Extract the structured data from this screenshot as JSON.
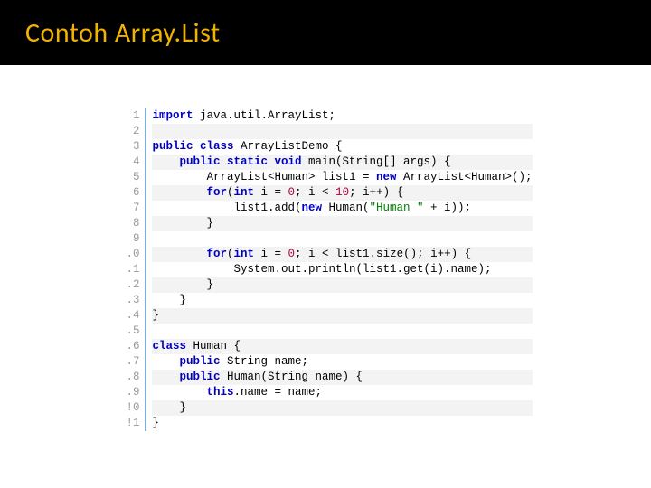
{
  "title": "Contoh Array.List",
  "line_numbers": [
    "1",
    "2",
    "3",
    "4",
    "5",
    "6",
    "7",
    "8",
    "9",
    ".0",
    ".1",
    ".2",
    ".3",
    ".4",
    ".5",
    ".6",
    ".7",
    ".8",
    ".9",
    "!0",
    "!1"
  ],
  "code": {
    "l1": {
      "kw1": "import",
      "rest": " java.util.ArrayList;"
    },
    "l2": {
      "blank": " "
    },
    "l3": {
      "kw1": "public class",
      "name": " ArrayListDemo ",
      "brace": "{"
    },
    "l4": {
      "pad": "    ",
      "kw1": "public static void",
      "name": " main(String[] args) ",
      "brace": "{"
    },
    "l5": {
      "pad": "        ",
      "pre": "ArrayList<Human> list1 = ",
      "kw1": "new",
      "post": " ArrayList<Human>();"
    },
    "l6": {
      "pad": "        ",
      "kw1": "for",
      "open": "(",
      "kw2": "int",
      "var": " i = ",
      "n0": "0",
      "mid": "; i < ",
      "n1": "10",
      "end": "; i++) {"
    },
    "l7": {
      "pad": "            ",
      "pre": "list1.add(",
      "kw1": "new",
      "mid": " Human(",
      "str": "\"Human \"",
      "post": " + i));"
    },
    "l8": {
      "pad": "        ",
      "brace": "}"
    },
    "l9": {
      "blank": " "
    },
    "l10": {
      "pad": "        ",
      "kw1": "for",
      "open": "(",
      "kw2": "int",
      "var": " i = ",
      "n0": "0",
      "end": "; i < list1.size(); i++) {"
    },
    "l11": {
      "pad": "            ",
      "text": "System.out.println(list1.get(i).name);"
    },
    "l12": {
      "pad": "        ",
      "brace": "}"
    },
    "l13": {
      "pad": "    ",
      "brace": "}"
    },
    "l14": {
      "brace": "}"
    },
    "l15": {
      "blank": " "
    },
    "l16": {
      "kw1": "class",
      "name": " Human ",
      "brace": "{"
    },
    "l17": {
      "pad": "    ",
      "kw1": "public",
      "post": " String name;"
    },
    "l18": {
      "pad": "    ",
      "kw1": "public",
      "post": " Human(String name) {"
    },
    "l19": {
      "pad": "        ",
      "kw1": "this",
      "post": ".name = name;"
    },
    "l20": {
      "pad": "    ",
      "brace": "}"
    },
    "l21": {
      "brace": "}"
    }
  }
}
